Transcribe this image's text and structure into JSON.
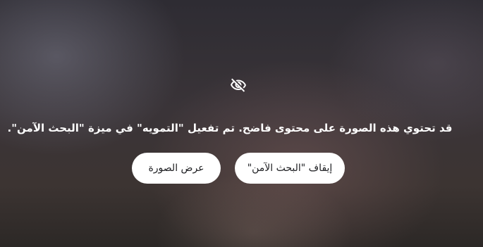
{
  "safe_search_notice": {
    "icon": "eye-off-icon",
    "message": "قد تحتوي هذه الصورة على محتوى فاضح. تم تفعيل \"التمويه\" في ميزة \"البحث الآمن\".",
    "turn_off_label": "إيقاف \"البحث الآمن\"",
    "show_image_label": "عرض الصورة"
  }
}
